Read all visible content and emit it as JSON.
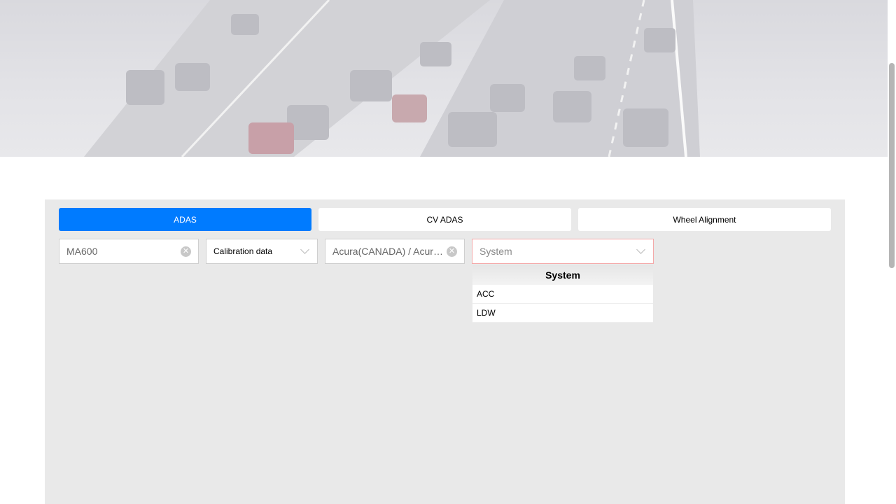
{
  "tabs": [
    {
      "label": "ADAS",
      "active": true
    },
    {
      "label": "CV ADAS",
      "active": false
    },
    {
      "label": "Wheel Alignment",
      "active": false
    }
  ],
  "filters": {
    "device": {
      "value": "MA600",
      "icon": "clear-icon"
    },
    "data_type": {
      "value": "Calibration data",
      "icon": "chevron-down-icon"
    },
    "vehicle": {
      "value": "Acura(CANADA) / Acura...",
      "icon": "clear-icon"
    },
    "system": {
      "placeholder": "System",
      "icon": "chevron-down-icon"
    }
  },
  "system_dropdown": {
    "header": "System",
    "options": [
      "ACC",
      "LDW"
    ]
  },
  "colors": {
    "accent": "#007bff",
    "panel": "#e9e9e9",
    "invalid_border": "#f4a9a9"
  }
}
